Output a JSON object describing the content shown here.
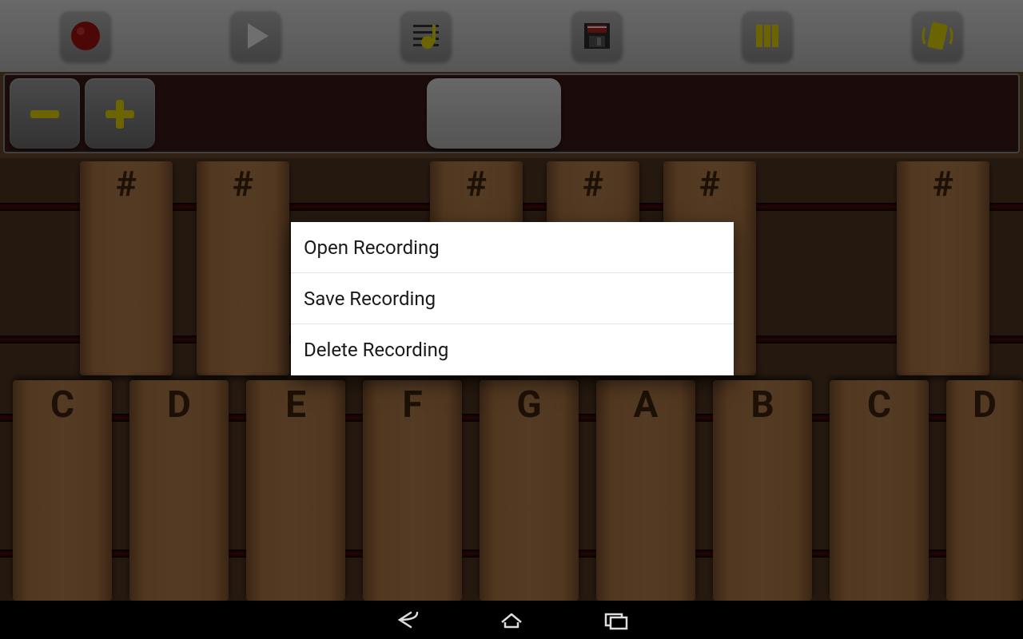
{
  "toolbar": {
    "record": "record",
    "play": "play",
    "notes": "notes",
    "save": "save",
    "pause": "pause",
    "vibrate": "vibrate"
  },
  "zoom": {
    "minus": "−",
    "plus": "+"
  },
  "sharps": [
    "#",
    "#",
    "#",
    "#",
    "#",
    "#"
  ],
  "naturals": [
    "C",
    "D",
    "E",
    "F",
    "G",
    "A",
    "B",
    "C",
    "D"
  ],
  "dialog": {
    "items": [
      {
        "label": "Open Recording"
      },
      {
        "label": "Save Recording"
      },
      {
        "label": "Delete Recording"
      }
    ]
  }
}
